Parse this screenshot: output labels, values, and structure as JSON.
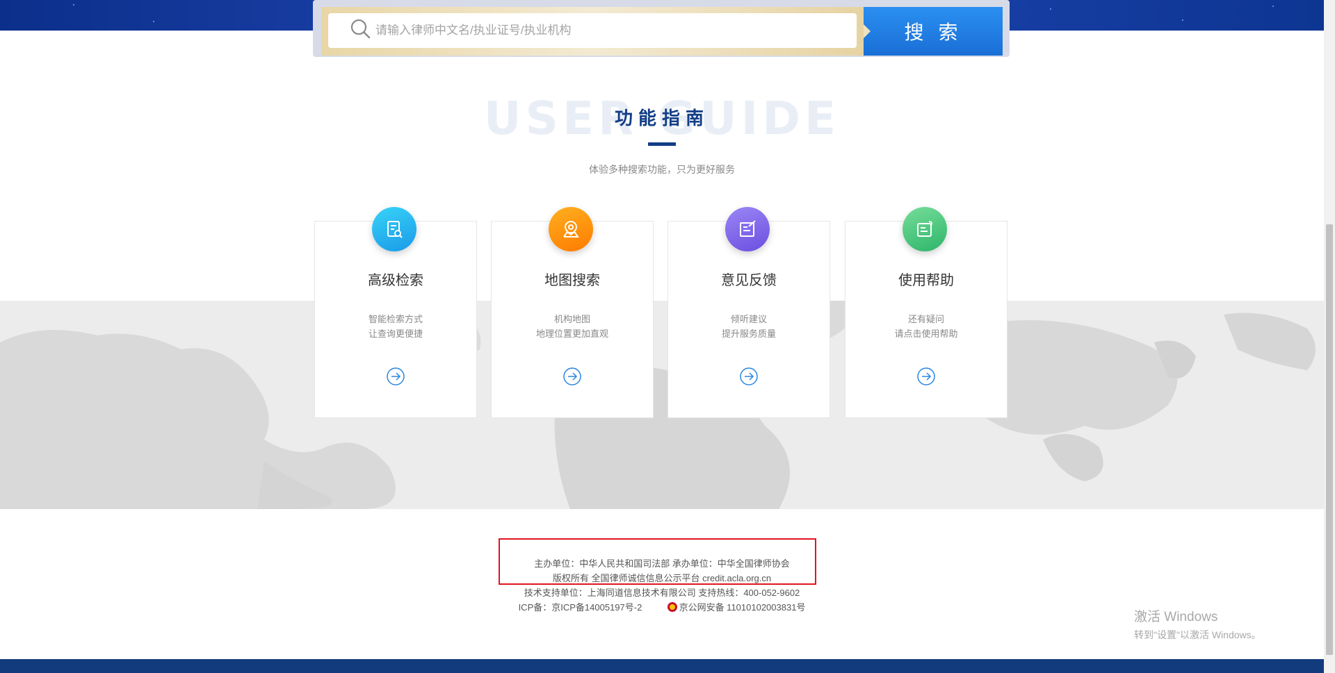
{
  "search": {
    "placeholder": "请输入律师中文名/执业证号/执业机构",
    "button_label": "搜 索"
  },
  "guide": {
    "bg_title": "USER GUIDE",
    "title": "功能指南",
    "subtitle": "体验多种搜索功能，只为更好服务",
    "cards": [
      {
        "title": "高级检索",
        "desc_line1": "智能检索方式",
        "desc_line2": "让查询更便捷",
        "icon": "document-search-icon",
        "color": "#1ab3f0"
      },
      {
        "title": "地图搜索",
        "desc_line1": "机构地图",
        "desc_line2": "地理位置更加直观",
        "icon": "map-pin-icon",
        "color": "#ff8a00"
      },
      {
        "title": "意见反馈",
        "desc_line1": "倾听建议",
        "desc_line2": "提升服务质量",
        "icon": "edit-icon",
        "color": "#7a62e8"
      },
      {
        "title": "使用帮助",
        "desc_line1": "还有疑问",
        "desc_line2": "请点击使用帮助",
        "icon": "help-document-icon",
        "color": "#3ebf78"
      }
    ]
  },
  "footer": {
    "line1": "主办单位：中华人民共和国司法部 承办单位：中华全国律师协会",
    "line2": "版权所有 全国律师诚信信息公示平台 credit.acla.org.cn",
    "line3": "技术支持单位：上海同道信息技术有限公司 支持热线：400-052-9602",
    "icp": "ICP备：京ICP备14005197号-2",
    "police": "京公网安备 11010102003831号"
  },
  "watermark": {
    "line1": "激活 Windows",
    "line2": "转到\"设置\"以激活 Windows。"
  },
  "colors": {
    "banner_blue": "#1a3fa6",
    "title_blue": "#123d86",
    "search_button": "#1a6fd6",
    "highlight_red": "#e0141e"
  }
}
